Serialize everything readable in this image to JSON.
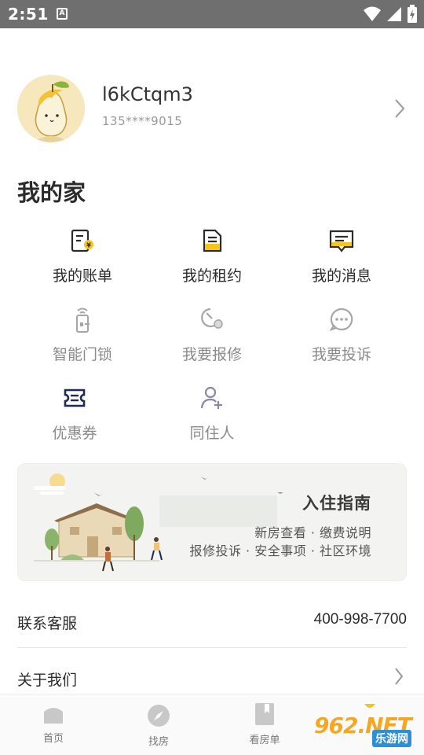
{
  "status_bar": {
    "time": "2:51",
    "notification_icon": "A"
  },
  "profile": {
    "username": "l6kCtqm3",
    "phone": "135****9015"
  },
  "home_section": {
    "title": "我的家",
    "items": [
      {
        "label": "我的账单",
        "icon": "bill-icon",
        "enabled": true
      },
      {
        "label": "我的租约",
        "icon": "lease-icon",
        "enabled": true
      },
      {
        "label": "我的消息",
        "icon": "message-icon",
        "enabled": true
      },
      {
        "label": "智能门锁",
        "icon": "smart-lock-icon",
        "enabled": false
      },
      {
        "label": "我要报修",
        "icon": "repair-icon",
        "enabled": false
      },
      {
        "label": "我要投诉",
        "icon": "complaint-icon",
        "enabled": false
      },
      {
        "label": "优惠券",
        "icon": "coupon-icon",
        "enabled": false
      },
      {
        "label": "同住人",
        "icon": "cohabitant-icon",
        "enabled": false
      }
    ]
  },
  "banner": {
    "title": "入住指南",
    "line1": "新房查看 · 缴费说明",
    "line2": "报修投诉 · 安全事项 · 社区环境"
  },
  "service": {
    "label": "联系客服",
    "phone": "400-998-7700"
  },
  "about": {
    "label": "关于我们"
  },
  "tabbar": {
    "tabs": [
      {
        "label": "首页",
        "icon": "home-icon"
      },
      {
        "label": "找房",
        "icon": "compass-icon"
      },
      {
        "label": "看房单",
        "icon": "bookmark-icon"
      }
    ]
  },
  "watermark": {
    "brand": "962.NET",
    "site": "乐游网"
  },
  "colors": {
    "accent": "#f5c518",
    "dark_icon": "#2b2b2b",
    "muted": "#8a8a8a"
  }
}
